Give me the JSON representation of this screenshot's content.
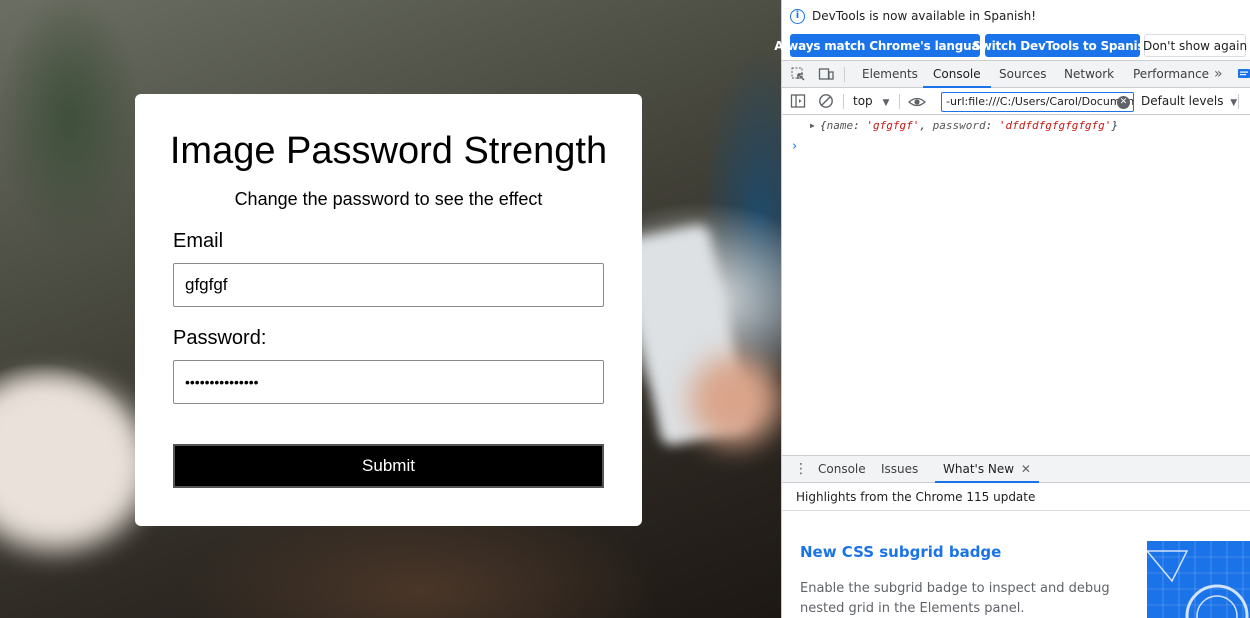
{
  "page": {
    "title": "Image Password Strength",
    "subtitle": "Change the password to see the effect",
    "email_label": "Email",
    "email_value": "gfgfgf",
    "password_label": "Password:",
    "password_masked": "•••••••••••••••",
    "submit_label": "Submit"
  },
  "devtools": {
    "infobar": {
      "message": "DevTools is now available in Spanish!",
      "btn_match": "Always match Chrome's language",
      "btn_switch": "Switch DevTools to Spanish",
      "btn_dismiss": "Don't show again"
    },
    "tabs": [
      "Elements",
      "Console",
      "Sources",
      "Network",
      "Performance"
    ],
    "active_tab": "Console",
    "toolbar": {
      "context": "top",
      "filter_value": "-url:file:///C:/Users/Carol/Documents",
      "levels": "Default levels"
    },
    "console": {
      "log_name_key": "name",
      "log_name_value": "'gfgfgf'",
      "log_password_key": "password",
      "log_password_value": "'dfdfdfgfgfgfgfg'"
    },
    "drawer": {
      "tabs": [
        "Console",
        "Issues",
        "What's New"
      ],
      "active_tab": "What's New",
      "highlights": "Highlights from the Chrome 115 update",
      "feature_title": "New CSS subgrid badge",
      "feature_desc": "Enable the subgrid badge to inspect and debug nested grid in the Elements panel."
    }
  },
  "colors": {
    "accent": "#1a73e8",
    "string": "#c41a16",
    "submit_bg": "#000000"
  }
}
